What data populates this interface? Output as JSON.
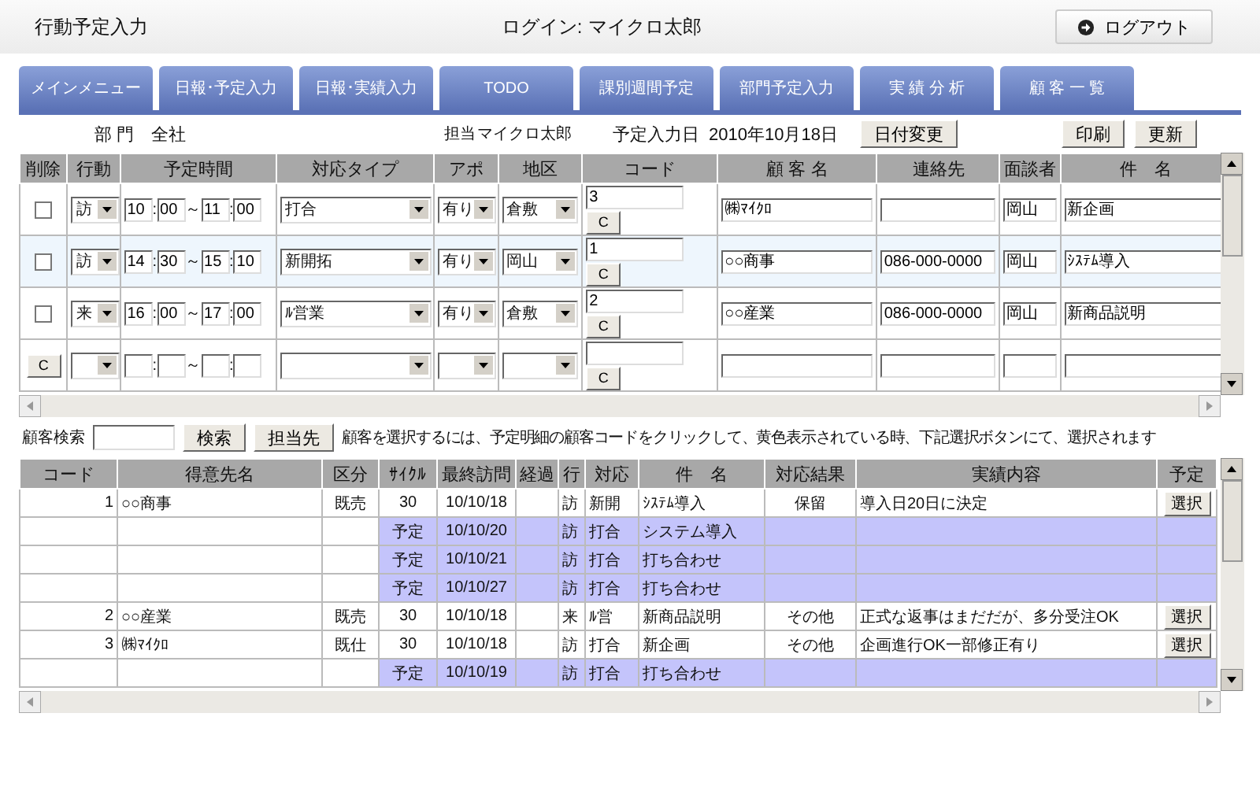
{
  "header": {
    "title": "行動予定入力",
    "login_label": "ログイン:",
    "login_user": "マイクロ太郎",
    "logout": "ログアウト"
  },
  "tabs": [
    {
      "label": "メインメニュー"
    },
    {
      "label": "日報･予定入力"
    },
    {
      "label": "日報･実績入力"
    },
    {
      "label": "TODO"
    },
    {
      "label": "課別週間予定"
    },
    {
      "label": "部門予定入力"
    },
    {
      "label": "実 績 分 析"
    },
    {
      "label": "顧 客 一 覧"
    }
  ],
  "info": {
    "dept_label": "部 門",
    "dept": "全社",
    "staff_label": "担当",
    "staff": "マイクロ太郎",
    "date_label": "予定入力日",
    "date": "2010年10月18日",
    "change_date": "日付変更",
    "print": "印刷",
    "refresh": "更新"
  },
  "upper": {
    "columns": [
      "削除",
      "行動",
      "予定時間",
      "対応タイプ",
      "アポ",
      "地区",
      "コード",
      "顧 客 名",
      "連絡先",
      "面談者",
      "件　名"
    ],
    "rows": [
      {
        "kind": "entry",
        "selected": false,
        "deleted": false,
        "action": "訪",
        "from_hour": "10",
        "colon1": ":",
        "from_min": "00",
        "tilde": "～",
        "to_hour": "11",
        "colon2": ":",
        "to_min": "00",
        "type": "打合",
        "appo": "有り",
        "area": "倉敷",
        "code": "3",
        "code_button": "C",
        "customer": "㈱ﾏｲｸﾛ",
        "interviewer": "岡山",
        "subject": "新企画"
      },
      {
        "kind": "entry",
        "selected": true,
        "deleted": false,
        "action": "訪",
        "from_hour": "14",
        "colon1": ":",
        "from_min": "30",
        "tilde": "～",
        "to_hour": "15",
        "colon2": ":",
        "to_min": "10",
        "type": "新開拓",
        "appo": "有り",
        "area": "岡山",
        "code": "1",
        "code_button": "C",
        "customer": "○○商事",
        "contact": "086-000-0000",
        "interviewer": "岡山",
        "subject": "ｼｽﾃﾑ導入"
      },
      {
        "kind": "entry",
        "selected": false,
        "deleted": false,
        "action": "来",
        "from_hour": "16",
        "colon1": ":",
        "from_min": "00",
        "tilde": "～",
        "to_hour": "17",
        "colon2": ":",
        "to_min": "00",
        "type": "ﾙ営業",
        "appo": "有り",
        "area": "倉敷",
        "code": "2",
        "code_button": "C",
        "customer": "○○産業",
        "contact": "086-000-0000",
        "interviewer": "岡山",
        "subject": "新商品説明"
      },
      {
        "kind": "new",
        "selected": false,
        "clear_button": "C",
        "colon1": ":",
        "tilde": "～",
        "colon2": ":",
        "code_button": "C"
      }
    ]
  },
  "search": {
    "label": "顧客検索",
    "search_button": "検索",
    "assigned_button": "担当先",
    "hint": "顧客を選択するには、予定明細の顧客コードをクリックして、黄色表示されている時、下記選択ボタンにて、選択されます"
  },
  "lower": {
    "columns": [
      "コード",
      "得意先名",
      "区分",
      "ｻｲｸﾙ",
      "最終訪問",
      "経過",
      "行",
      "対応",
      "件　名",
      "対応結果",
      "実績内容",
      "予定"
    ],
    "rows": [
      {
        "kind": "customer",
        "code": "1",
        "name": "○○商事",
        "category": "既売",
        "cycle": "30",
        "last_visit": "10/10/18",
        "action": "訪",
        "type": "新開",
        "subject": "ｼｽﾃﾑ導入",
        "result": "保留",
        "content": "導入日20日に決定",
        "button": "選択"
      },
      {
        "kind": "plan",
        "cycle": "予定",
        "last_visit": "10/10/20",
        "action": "訪",
        "type": "打合",
        "subject": "システム導入"
      },
      {
        "kind": "plan",
        "cycle": "予定",
        "last_visit": "10/10/21",
        "action": "訪",
        "type": "打合",
        "subject": "打ち合わせ"
      },
      {
        "kind": "plan",
        "cycle": "予定",
        "last_visit": "10/10/27",
        "action": "訪",
        "type": "打合",
        "subject": "打ち合わせ"
      },
      {
        "kind": "customer",
        "code": "2",
        "name": "○○産業",
        "category": "既売",
        "cycle": "30",
        "last_visit": "10/10/18",
        "action": "来",
        "type": "ﾙ営",
        "subject": "新商品説明",
        "result": "その他",
        "content": "正式な返事はまだだが、多分受注OK",
        "button": "選択"
      },
      {
        "kind": "customer",
        "code": "3",
        "name": "㈱ﾏｲｸﾛ",
        "category": "既仕",
        "cycle": "30",
        "last_visit": "10/10/18",
        "action": "訪",
        "type": "打合",
        "subject": "新企画",
        "result": "その他",
        "content": "企画進行OK一部修正有り",
        "button": "選択"
      },
      {
        "kind": "plan",
        "cycle": "予定",
        "last_visit": "10/10/19",
        "action": "訪",
        "type": "打合",
        "subject": "打ち合わせ"
      }
    ]
  }
}
